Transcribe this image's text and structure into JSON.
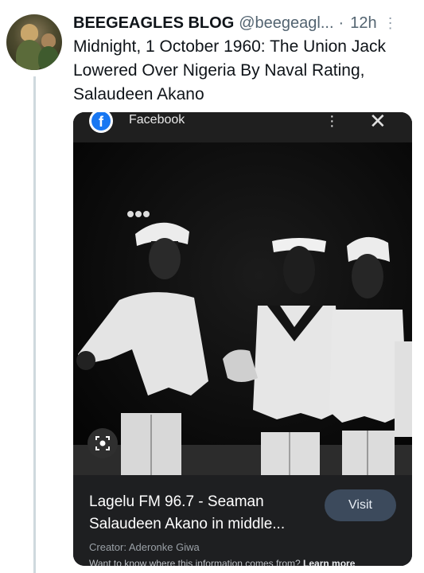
{
  "tweet": {
    "author_name": "BEEGEAGLES BLOG",
    "handle": "@beegeagl...",
    "separator": "·",
    "time": "12h",
    "more_glyph": "⋮",
    "text": "Midnight, 1 October 1960: The Union Jack Lowered Over Nigeria By Naval Rating, Salaudeen Akano"
  },
  "card": {
    "source_label": "Facebook",
    "source_icon": "facebook-icon",
    "menu_icon": "kebab-menu-icon",
    "close_icon": "close-icon",
    "lens_icon": "google-lens-icon",
    "caption": "Lagelu FM 96.7 - Seaman Salaudeen Akano in middle...",
    "visit_label": "Visit",
    "creator": "Creator: Aderonke Giwa",
    "more_text": "Want to know where this information comes from?",
    "more_link": "Learn more"
  },
  "colors": {
    "card_background": "#121212",
    "visit_button": "#3c4a5c",
    "thread_line": "#cfd9de",
    "facebook_blue": "#1877f2"
  }
}
